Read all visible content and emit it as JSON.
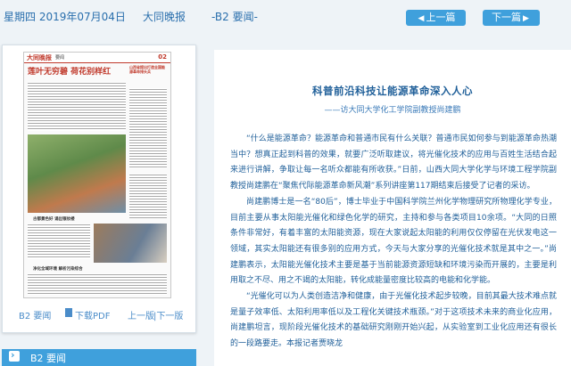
{
  "header": {
    "date": "星期四 2019年07月04日",
    "paper": "大同晚报",
    "page": "-B2 要闻-",
    "prev_btn": "上一篇",
    "next_btn": "下一篇"
  },
  "thumbnail": {
    "masthead_logo": "大同晚报",
    "masthead_section": "要闻",
    "masthead_no": "02",
    "headline": "莲叶无穷碧 荷花别样红",
    "side_headline": "山西省提出打造全国能源革命排头兵",
    "caption1": "古都景色好 诵出银妆楼",
    "caption2": "净化全域环境 解析污染综合",
    "photo_colors": [
      "#5f8a4a",
      "#b0623f",
      "#6a7e95"
    ]
  },
  "left_panel": {
    "page_link": "B2 要闻",
    "pdf_link": "下载PDF",
    "prev_page": "上一版",
    "next_page": "|下一版"
  },
  "section_bar": {
    "label": "B2 要闻"
  },
  "article": {
    "title": "科普前沿科技让能源革命深入人心",
    "subtitle": "——访大同大学化工学院副教授尚建鹏",
    "paragraphs": [
      "“什么是能源革命？能源革命和普通市民有什么关联？普通市民如何参与到能源革命热潮当中？想真正起到科普的效果，就要广泛听取建议，将光催化技术的应用与百姓生活结合起来进行讲解，争取让每一名听众都能有所收获。”日前，山西大同大学化学与环境工程学院副教授尚建鹏在“聚焦代际能源革命新风潮”系列讲座第117期结束后接受了记者的采访。",
      "尚建鹏博士是一名“80后”，博士毕业于中国科学院兰州化学物理研究所物理化学专业，目前主要从事太阳能光催化和绿色化学的研究，主持和参与各类项目10余项。“大同的日照条件非常好，有着丰富的太阳能资源，现在大家说起太阳能的利用仅仅停留在光伏发电这一领域，其实太阳能还有很多别的应用方式，今天与大家分享的光催化技术就是其中之一。”尚建鹏表示，太阳能光催化技术主要是基于当前能源资源短缺和环境污染而开展的，主要是利用取之不尽、用之不竭的太阳能，转化成能量密度比较高的电能和化学能。",
      "“光催化可以为人类创造洁净和健康，由于光催化技术起步较晚，目前其最大技术难点就是量子效率低、太阳利用率低以及工程化关键技术瓶颈。”对于这项技术未来的商业化应用，尚建鹏坦言，现阶段光催化技术的基础研究刚刚开始兴起，从实验室到工业化应用还有很长的一段路要走。本报记者贾晓龙"
    ]
  }
}
